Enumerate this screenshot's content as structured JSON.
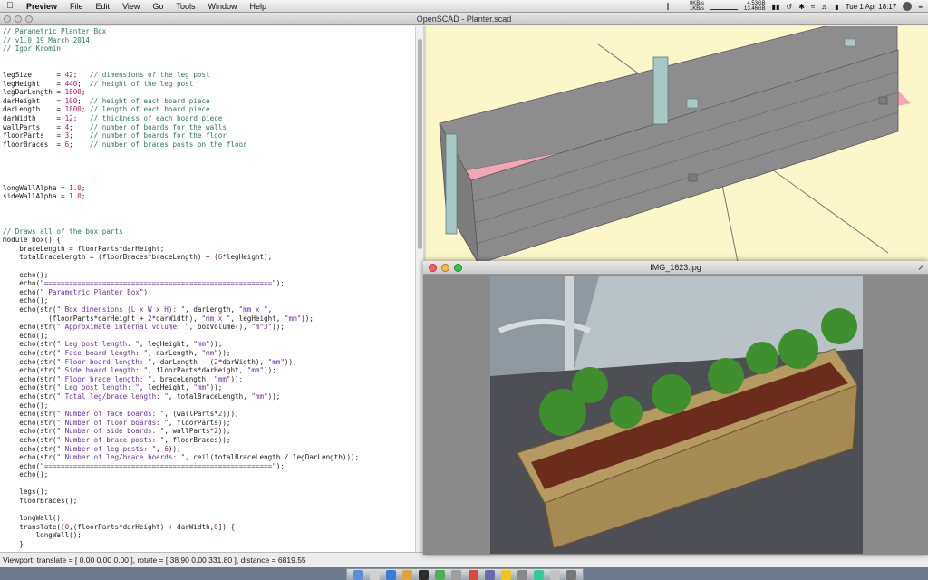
{
  "menubar": {
    "app": "Preview",
    "items": [
      "File",
      "Edit",
      "View",
      "Go",
      "Tools",
      "Window",
      "Help"
    ],
    "net_up": "0KB/s",
    "net_down": "1KB/s",
    "mem1": "4.53GB",
    "mem2": "13.46GB",
    "datetime": "Tue 1 Apr  18:17"
  },
  "window": {
    "title": "OpenSCAD - Planter.scad"
  },
  "editor": {
    "lines": [
      [
        [
          "c",
          "// Parametric Planter Box"
        ]
      ],
      [
        [
          "c",
          "// v1.0 19 March 2014"
        ]
      ],
      [
        [
          "c",
          "// Igor Kromin"
        ]
      ],
      [],
      [],
      [
        [
          "t",
          "legSize      = "
        ],
        [
          "n",
          "42"
        ],
        [
          "t",
          ";   "
        ],
        [
          "c",
          "// dimensions of the leg post"
        ]
      ],
      [
        [
          "t",
          "legHeight    = "
        ],
        [
          "n",
          "440"
        ],
        [
          "t",
          ";  "
        ],
        [
          "c",
          "// height of the leg post"
        ]
      ],
      [
        [
          "t",
          "legDarLength = "
        ],
        [
          "n",
          "1800"
        ],
        [
          "t",
          ";"
        ]
      ],
      [
        [
          "t",
          "darHeight    = "
        ],
        [
          "n",
          "100"
        ],
        [
          "t",
          ";  "
        ],
        [
          "c",
          "// height of each board piece"
        ]
      ],
      [
        [
          "t",
          "darLength    = "
        ],
        [
          "n",
          "1800"
        ],
        [
          "t",
          "; "
        ],
        [
          "c",
          "// length of each board piece"
        ]
      ],
      [
        [
          "t",
          "darWidth     = "
        ],
        [
          "n",
          "12"
        ],
        [
          "t",
          ";   "
        ],
        [
          "c",
          "// thickness of each board piece"
        ]
      ],
      [
        [
          "t",
          "wallParts    = "
        ],
        [
          "n",
          "4"
        ],
        [
          "t",
          ";    "
        ],
        [
          "c",
          "// number of boards for the walls"
        ]
      ],
      [
        [
          "t",
          "floorParts   = "
        ],
        [
          "n",
          "3"
        ],
        [
          "t",
          ";    "
        ],
        [
          "c",
          "// number of boards for the floor"
        ]
      ],
      [
        [
          "t",
          "floorBraces  = "
        ],
        [
          "n",
          "6"
        ],
        [
          "t",
          ";    "
        ],
        [
          "c",
          "// number of braces posts on the floor"
        ]
      ],
      [],
      [],
      [],
      [],
      [
        [
          "t",
          "longWallAlpha = "
        ],
        [
          "n",
          "1.0"
        ],
        [
          "t",
          ";"
        ]
      ],
      [
        [
          "t",
          "sideWallAlpha = "
        ],
        [
          "n",
          "1.0"
        ],
        [
          "t",
          ";"
        ]
      ],
      [],
      [],
      [],
      [
        [
          "c",
          "// Draws all of the box parts"
        ]
      ],
      [
        [
          "t",
          "module box() {"
        ]
      ],
      [
        [
          "t",
          "    braceLength = floorParts*darHeight;"
        ]
      ],
      [
        [
          "t",
          "    totalBraceLength = (floorBraces*braceLength) + ("
        ],
        [
          "n",
          "6"
        ],
        [
          "t",
          "*legHeight);"
        ]
      ],
      [],
      [
        [
          "t",
          "    echo();"
        ]
      ],
      [
        [
          "t",
          "    echo("
        ],
        [
          "s",
          "\"=======================================================\""
        ],
        [
          "t",
          ");"
        ]
      ],
      [
        [
          "t",
          "    echo("
        ],
        [
          "s",
          "\" Parametric Planter Box\""
        ],
        [
          "t",
          ");"
        ]
      ],
      [
        [
          "t",
          "    echo();"
        ]
      ],
      [
        [
          "t",
          "    echo(str("
        ],
        [
          "s",
          "\" Box dimensions (L x W x H): \""
        ],
        [
          "t",
          ", darLength, "
        ],
        [
          "s",
          "\"mm x \""
        ],
        [
          "t",
          ","
        ]
      ],
      [
        [
          "t",
          "           (floorParts*darHeight + "
        ],
        [
          "n",
          "2"
        ],
        [
          "t",
          "*darWidth), "
        ],
        [
          "s",
          "\"mm x \""
        ],
        [
          "t",
          ", legHeight, "
        ],
        [
          "s",
          "\"mm\""
        ],
        [
          "t",
          "));"
        ]
      ],
      [
        [
          "t",
          "    echo(str("
        ],
        [
          "s",
          "\" Approximate internal volume: \""
        ],
        [
          "t",
          ", boxVolume(), "
        ],
        [
          "s",
          "\"m^3\""
        ],
        [
          "t",
          "));"
        ]
      ],
      [
        [
          "t",
          "    echo();"
        ]
      ],
      [
        [
          "t",
          "    echo(str("
        ],
        [
          "s",
          "\" Leg post length: \""
        ],
        [
          "t",
          ", legHeight, "
        ],
        [
          "s",
          "\"mm\""
        ],
        [
          "t",
          "));"
        ]
      ],
      [
        [
          "t",
          "    echo(str("
        ],
        [
          "s",
          "\" Face board length: \""
        ],
        [
          "t",
          ", darLength, "
        ],
        [
          "s",
          "\"mm\""
        ],
        [
          "t",
          "));"
        ]
      ],
      [
        [
          "t",
          "    echo(str("
        ],
        [
          "s",
          "\" Floor board length: \""
        ],
        [
          "t",
          ", darLength - ("
        ],
        [
          "n",
          "2"
        ],
        [
          "t",
          "*darWidth), "
        ],
        [
          "s",
          "\"mm\""
        ],
        [
          "t",
          "));"
        ]
      ],
      [
        [
          "t",
          "    echo(str("
        ],
        [
          "s",
          "\" Side board length: \""
        ],
        [
          "t",
          ", floorParts*darHeight, "
        ],
        [
          "s",
          "\"mm\""
        ],
        [
          "t",
          "));"
        ]
      ],
      [
        [
          "t",
          "    echo(str("
        ],
        [
          "s",
          "\" Floor brace length: \""
        ],
        [
          "t",
          ", braceLength, "
        ],
        [
          "s",
          "\"mm\""
        ],
        [
          "t",
          "));"
        ]
      ],
      [
        [
          "t",
          "    echo(str("
        ],
        [
          "s",
          "\" Leg post length: \""
        ],
        [
          "t",
          ", legHeight, "
        ],
        [
          "s",
          "\"mm\""
        ],
        [
          "t",
          "));"
        ]
      ],
      [
        [
          "t",
          "    echo(str("
        ],
        [
          "s",
          "\" Total leg/brace length: \""
        ],
        [
          "t",
          ", totalBraceLength, "
        ],
        [
          "s",
          "\"mm\""
        ],
        [
          "t",
          "));"
        ]
      ],
      [
        [
          "t",
          "    echo();"
        ]
      ],
      [
        [
          "t",
          "    echo(str("
        ],
        [
          "s",
          "\" Number of face boards: \""
        ],
        [
          "t",
          ", (wallParts*"
        ],
        [
          "n",
          "2"
        ],
        [
          "t",
          ")));"
        ]
      ],
      [
        [
          "t",
          "    echo(str("
        ],
        [
          "s",
          "\" Number of floor boards: \""
        ],
        [
          "t",
          ", floorParts));"
        ]
      ],
      [
        [
          "t",
          "    echo(str("
        ],
        [
          "s",
          "\" Number of side boards: \""
        ],
        [
          "t",
          ", wallParts*"
        ],
        [
          "n",
          "2"
        ],
        [
          "t",
          "));"
        ]
      ],
      [
        [
          "t",
          "    echo(str("
        ],
        [
          "s",
          "\" Number of brace posts: \""
        ],
        [
          "t",
          ", floorBraces));"
        ]
      ],
      [
        [
          "t",
          "    echo(str("
        ],
        [
          "s",
          "\" Number of leg posts: \""
        ],
        [
          "t",
          ", "
        ],
        [
          "n",
          "6"
        ],
        [
          "t",
          "));"
        ]
      ],
      [
        [
          "t",
          "    echo(str("
        ],
        [
          "s",
          "\" Number of leg/brace boards: \""
        ],
        [
          "t",
          ", ceil(totalBraceLength / legDarLength)));"
        ]
      ],
      [
        [
          "t",
          "    echo("
        ],
        [
          "s",
          "\"=======================================================\""
        ],
        [
          "t",
          ");"
        ]
      ],
      [
        [
          "t",
          "    echo();"
        ]
      ],
      [],
      [
        [
          "t",
          "    legs();"
        ]
      ],
      [
        [
          "t",
          "    floorBraces();"
        ]
      ],
      [],
      [
        [
          "t",
          "    longWall();"
        ]
      ],
      [
        [
          "t",
          "    translate(["
        ],
        [
          "n",
          "0"
        ],
        [
          "t",
          ",(floorParts*darHeight) + darWidth,"
        ],
        [
          "n",
          "0"
        ],
        [
          "t",
          "]) {"
        ]
      ],
      [
        [
          "t",
          "        longWall();"
        ]
      ],
      [
        [
          "t",
          "    }"
        ]
      ]
    ]
  },
  "statusbar": {
    "text": "Viewport: translate = [ 0.00 0.00 0.00 ], rotate = [ 38.90 0.00 331.80 ], distance = 6819.55"
  },
  "preview": {
    "title": "IMG_1623.jpg"
  },
  "colors": {
    "view_bg": "#fbf7c8",
    "board": "#8b8b8b",
    "floor_highlight": "#f2a8b4",
    "post": "#a8c8c6",
    "code_comment": "#2d7a5a",
    "code_number": "#b2186e",
    "code_string": "#6a2ea8"
  }
}
